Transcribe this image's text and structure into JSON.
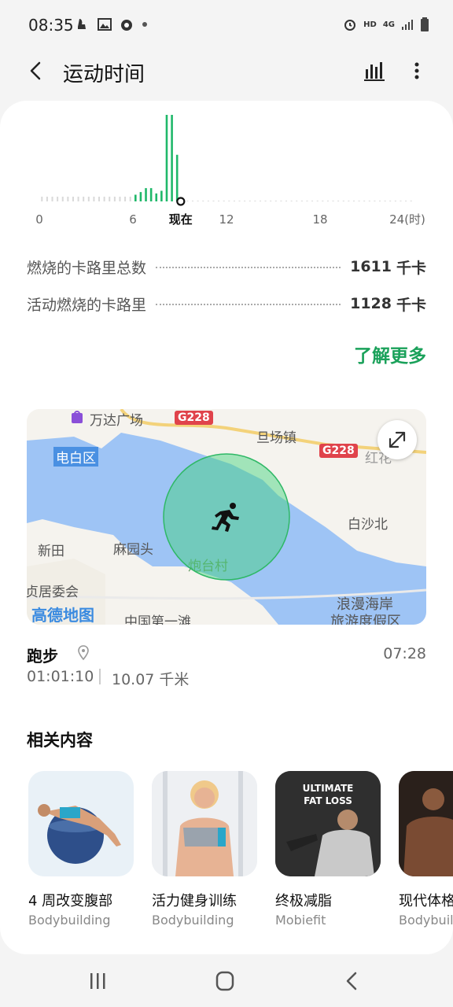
{
  "status_bar": {
    "time": "08:35",
    "left_icons": [
      "steps-icon",
      "gallery-icon",
      "app-icon",
      "dot-icon"
    ],
    "right_icons": [
      "alarm-icon",
      "hd-icon",
      "4g-signal-icon",
      "battery-icon"
    ],
    "hd_label": "HD",
    "network_label": "4G"
  },
  "app_bar": {
    "title": "运动时间",
    "back_icon": "chevron-left-icon",
    "chart_icon": "bar-chart-icon",
    "more_icon": "more-vertical-icon"
  },
  "chart_data": {
    "type": "bar",
    "x_ticks": [
      "0",
      "6",
      "现在",
      "12",
      "18",
      "24(时)"
    ],
    "current_marker_label": "现在",
    "bin_minutes": 20,
    "colors": {
      "active": "#1fb86a",
      "inactive": "#d9d9d9"
    },
    "values": [
      0,
      0,
      0,
      0,
      0,
      0,
      0,
      0,
      0,
      0,
      0,
      0,
      0,
      0,
      0,
      0,
      0,
      0,
      0.5,
      0.7,
      1,
      1,
      0.6,
      0.8,
      6.5,
      6.5,
      3.5,
      0,
      0,
      0,
      0,
      0,
      0,
      0,
      0,
      0,
      0,
      0,
      0,
      0,
      0,
      0,
      0,
      0,
      0,
      0,
      0,
      0,
      0,
      0,
      0,
      0,
      0,
      0,
      0,
      0,
      0,
      0,
      0,
      0,
      0,
      0,
      0,
      0,
      0,
      0,
      0,
      0,
      0,
      0,
      0,
      0
    ],
    "current_index": 27
  },
  "stats": [
    {
      "label": "燃烧的卡路里总数",
      "value": "1611",
      "unit": "千卡"
    },
    {
      "label": "活动燃烧的卡路里",
      "value": "1128",
      "unit": "千卡"
    }
  ],
  "learn_more": "了解更多",
  "map": {
    "labels": [
      "万达广场",
      "电白区",
      "旦场镇",
      "红花",
      "白沙北",
      "新田",
      "麻园头",
      "炮台村",
      "贞居委会",
      "高德地图",
      "中国第一滩",
      "浪漫海岸",
      "旅游度假区"
    ],
    "highways": [
      "G228",
      "G228"
    ],
    "expand_icon": "expand-icon",
    "activity_icon": "running-icon"
  },
  "activity": {
    "title": "跑步",
    "time": "07:28",
    "duration": "01:01:10",
    "distance": "10.07 千米"
  },
  "related": {
    "title": "相关内容",
    "items": [
      {
        "name": "4 周改变腹部",
        "source": "Bodybuilding",
        "color": "#e9f1f7"
      },
      {
        "name": "活力健身训练",
        "source": "Bodybuilding",
        "color": "#e5e9ef"
      },
      {
        "name": "终极减脂",
        "source": "Mobiefit",
        "color": "#2b2b2b",
        "overlay": "ULTIMATE\nFAT LOSS"
      },
      {
        "name": "现代体格",
        "source": "Bodybuild",
        "color": "#3a2a22"
      }
    ]
  },
  "nav_bar": {
    "icons": [
      "recent-apps-icon",
      "home-icon",
      "back-icon"
    ]
  }
}
